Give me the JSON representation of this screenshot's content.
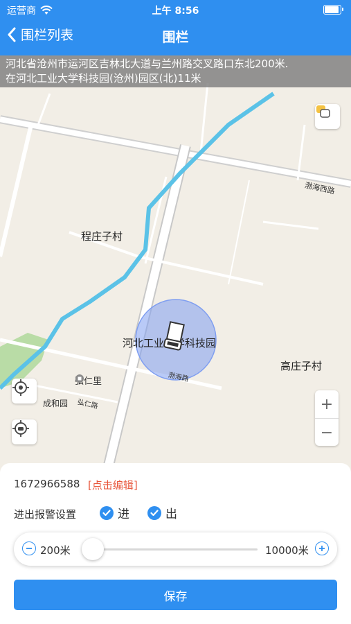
{
  "status_bar": {
    "carrier": "运营商",
    "time": "上午 8:56"
  },
  "nav": {
    "back_label": "围栏列表",
    "title": "围栏"
  },
  "address": {
    "line1": "河北省沧州市运河区吉林北大道与兰州路交叉路口东北200米.",
    "line2": "在河北工业大学科技园(沧州)园区(北)11米"
  },
  "map": {
    "labels": {
      "village1": "程庄子村",
      "village2": "高庄子村",
      "park": "河北工业大学科技园",
      "poi": "弘仁里",
      "road1": "渤海西路",
      "road2": "渤海路",
      "road3": "弘仁路",
      "community": "成和园",
      "faint1": "子村",
      "faint2": "渤海路"
    },
    "zoom_in": "+",
    "zoom_out": "−"
  },
  "panel": {
    "phone": "1672966588",
    "edit_label": "[点击编辑]",
    "alarm_label": "进出报警设置",
    "check_in": {
      "label": "进",
      "checked": true
    },
    "check_out": {
      "label": "出",
      "checked": true
    },
    "radius": {
      "min_label": "200米",
      "max_label": "10000米",
      "min": 200,
      "max": 10000,
      "value": 200
    },
    "save_label": "保存"
  },
  "colors": {
    "primary": "#2f8ff0",
    "edit": "#e8553a",
    "river": "#5bc2e7",
    "fence": "#7f9ef0"
  },
  "icons": [
    "back-chevron-icon",
    "wifi-icon",
    "battery-icon",
    "layers-icon",
    "locate-icon",
    "car-locate-icon",
    "truck-icon",
    "poi-icon",
    "check-icon",
    "minus-icon",
    "plus-icon"
  ]
}
